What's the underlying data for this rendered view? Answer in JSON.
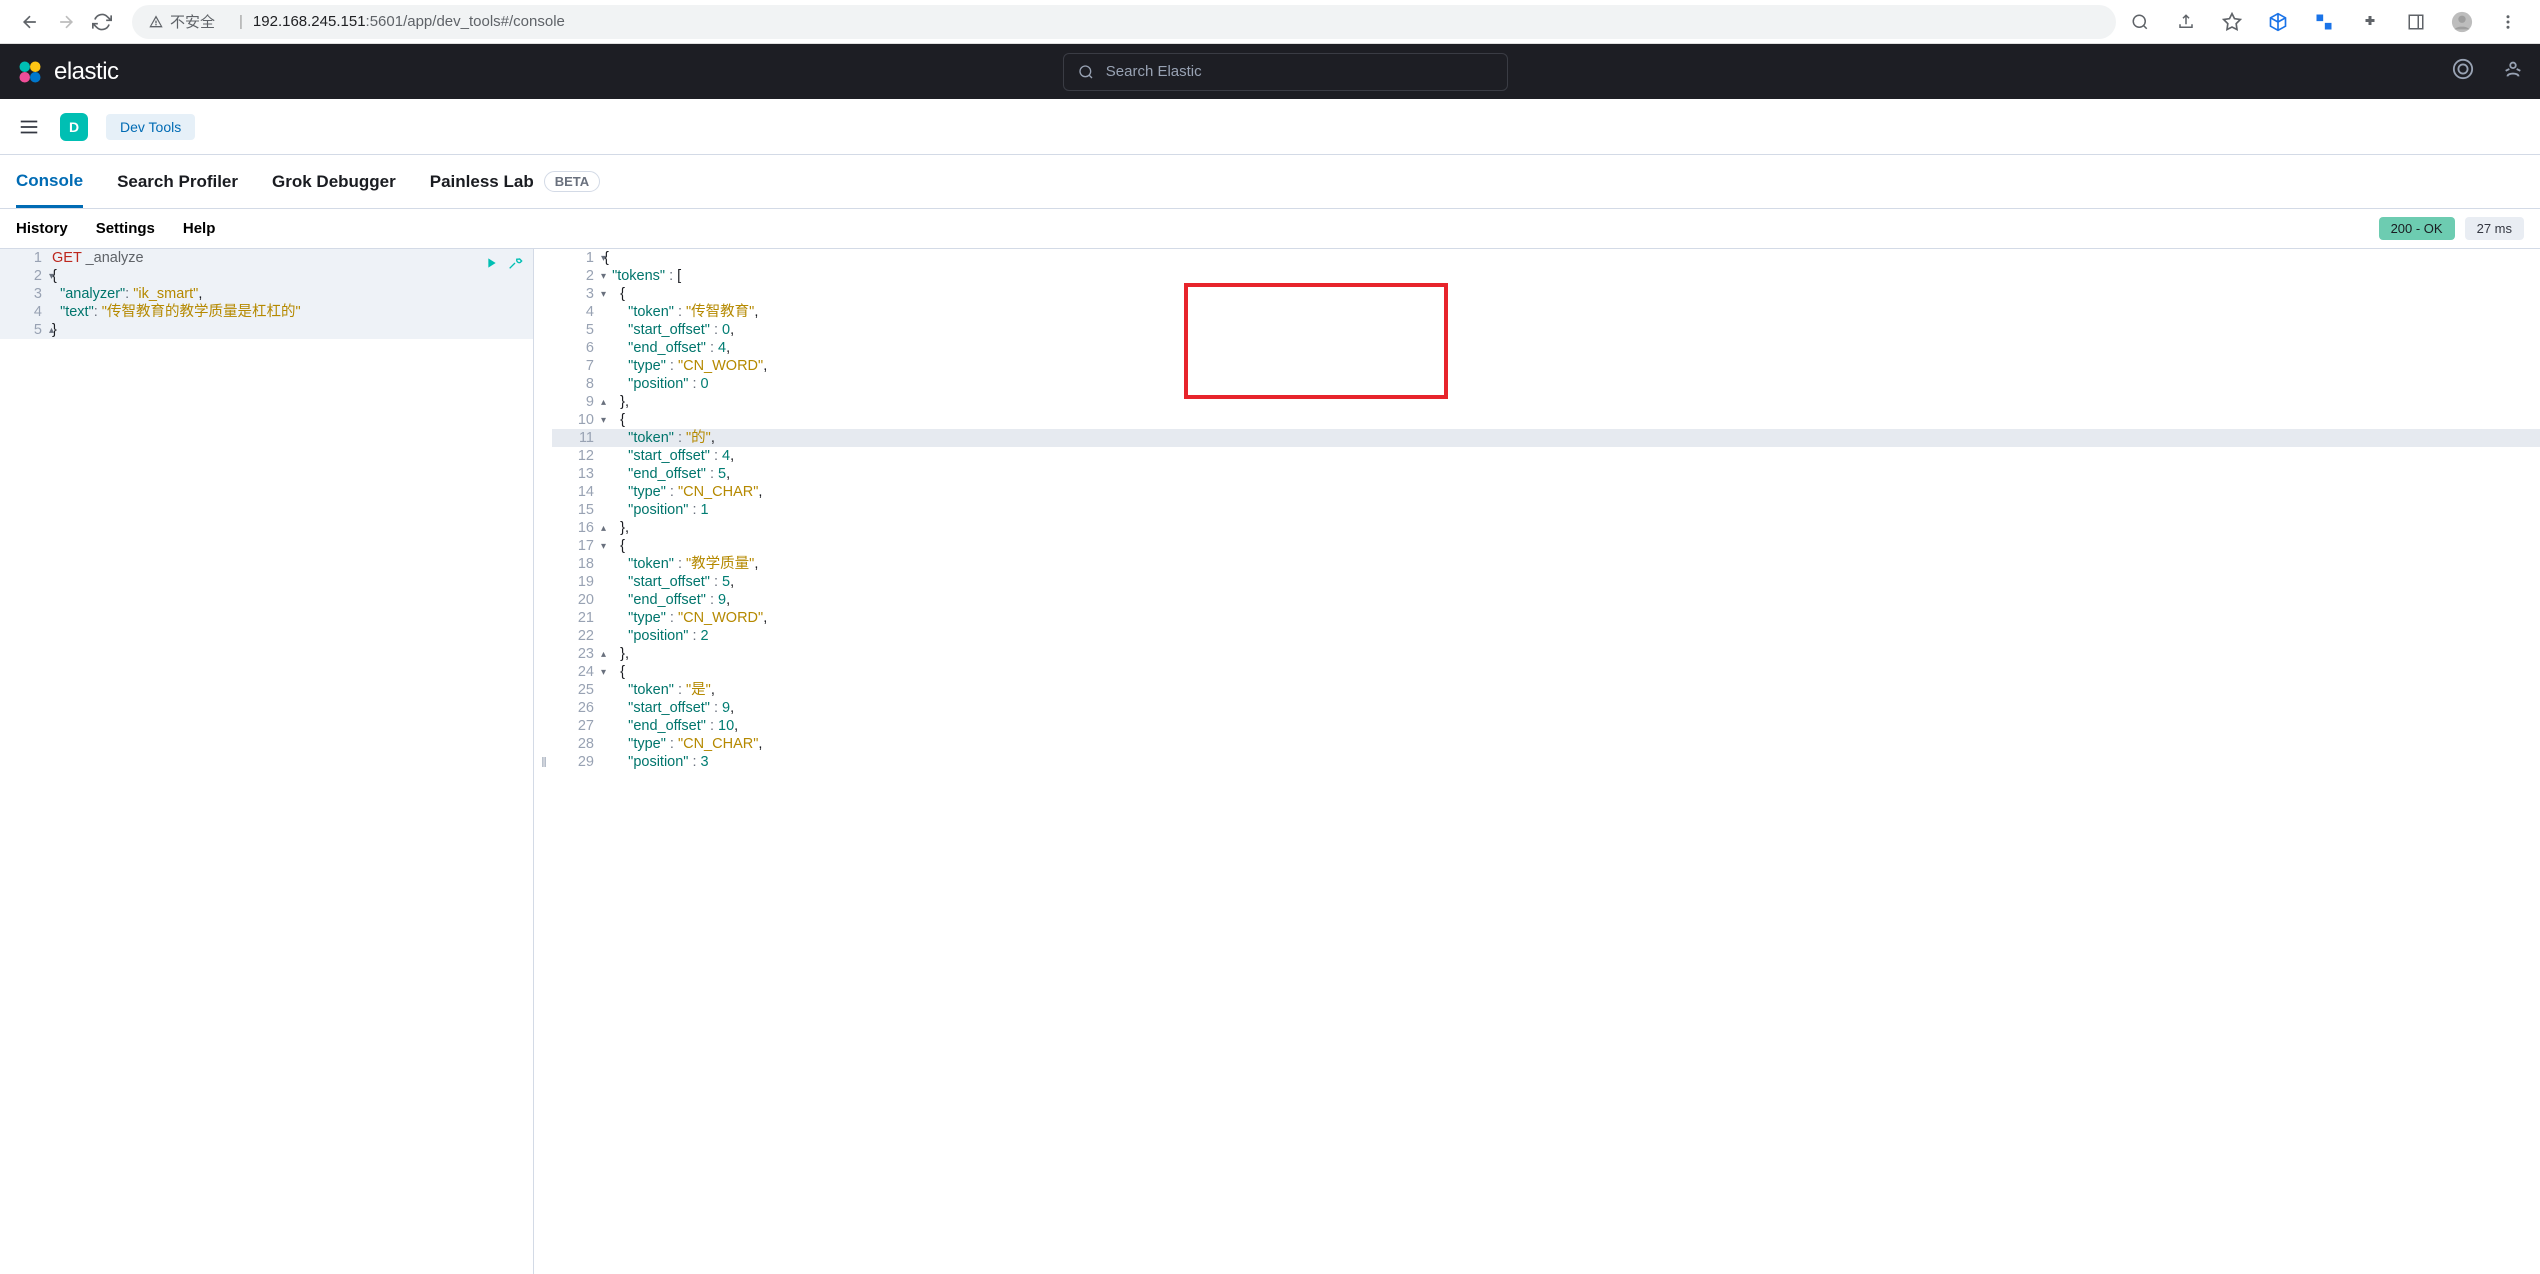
{
  "browser": {
    "insecure_label": "不安全",
    "host": "192.168.245.151",
    "port_path": ":5601/app/dev_tools#/console"
  },
  "header": {
    "brand": "elastic",
    "search_placeholder": "Search Elastic",
    "app_badge_letter": "D",
    "dev_tools_label": "Dev Tools"
  },
  "tabs": [
    {
      "label": "Console",
      "active": true
    },
    {
      "label": "Search Profiler"
    },
    {
      "label": "Grok Debugger"
    },
    {
      "label": "Painless Lab",
      "beta": "BETA"
    }
  ],
  "toolbar": {
    "history": "History",
    "settings": "Settings",
    "help": "Help",
    "status": "200 - OK",
    "time": "27 ms"
  },
  "request": {
    "method": "GET",
    "path": "_analyze",
    "body": {
      "analyzer": "ik_smart",
      "text": "传智教育的教学质量是杠杠的"
    }
  },
  "response_lines": [
    {
      "n": 1,
      "fold": "▾",
      "indent": 0,
      "tokens": [
        {
          "c": "t-brace",
          "t": "{"
        }
      ]
    },
    {
      "n": 2,
      "fold": "▾",
      "indent": 1,
      "tokens": [
        {
          "c": "t-key",
          "t": "\"tokens\""
        },
        {
          "c": "t-colon",
          "t": " : "
        },
        {
          "c": "t-brace",
          "t": "["
        }
      ]
    },
    {
      "n": 3,
      "fold": "▾",
      "indent": 2,
      "tokens": [
        {
          "c": "t-brace",
          "t": "{"
        }
      ]
    },
    {
      "n": 4,
      "indent": 3,
      "tokens": [
        {
          "c": "t-key",
          "t": "\"token\""
        },
        {
          "c": "t-colon",
          "t": " : "
        },
        {
          "c": "t-string",
          "t": "\"传智教育\""
        },
        {
          "c": "t-brace",
          "t": ","
        }
      ]
    },
    {
      "n": 5,
      "indent": 3,
      "tokens": [
        {
          "c": "t-key",
          "t": "\"start_offset\""
        },
        {
          "c": "t-colon",
          "t": " : "
        },
        {
          "c": "t-number",
          "t": "0"
        },
        {
          "c": "t-brace",
          "t": ","
        }
      ]
    },
    {
      "n": 6,
      "indent": 3,
      "tokens": [
        {
          "c": "t-key",
          "t": "\"end_offset\""
        },
        {
          "c": "t-colon",
          "t": " : "
        },
        {
          "c": "t-number",
          "t": "4"
        },
        {
          "c": "t-brace",
          "t": ","
        }
      ]
    },
    {
      "n": 7,
      "indent": 3,
      "tokens": [
        {
          "c": "t-key",
          "t": "\"type\""
        },
        {
          "c": "t-colon",
          "t": " : "
        },
        {
          "c": "t-string",
          "t": "\"CN_WORD\""
        },
        {
          "c": "t-brace",
          "t": ","
        }
      ]
    },
    {
      "n": 8,
      "indent": 3,
      "tokens": [
        {
          "c": "t-key",
          "t": "\"position\""
        },
        {
          "c": "t-colon",
          "t": " : "
        },
        {
          "c": "t-number",
          "t": "0"
        }
      ]
    },
    {
      "n": 9,
      "fold": "▴",
      "indent": 2,
      "tokens": [
        {
          "c": "t-brace",
          "t": "},"
        }
      ]
    },
    {
      "n": 10,
      "fold": "▾",
      "indent": 2,
      "tokens": [
        {
          "c": "t-brace",
          "t": "{"
        }
      ]
    },
    {
      "n": 11,
      "indent": 3,
      "current": true,
      "tokens": [
        {
          "c": "t-key",
          "t": "\"token\""
        },
        {
          "c": "t-colon",
          "t": " : "
        },
        {
          "c": "t-string",
          "t": "\"的\""
        },
        {
          "c": "t-brace",
          "t": ","
        }
      ]
    },
    {
      "n": 12,
      "indent": 3,
      "tokens": [
        {
          "c": "t-key",
          "t": "\"start_offset\""
        },
        {
          "c": "t-colon",
          "t": " : "
        },
        {
          "c": "t-number",
          "t": "4"
        },
        {
          "c": "t-brace",
          "t": ","
        }
      ]
    },
    {
      "n": 13,
      "indent": 3,
      "tokens": [
        {
          "c": "t-key",
          "t": "\"end_offset\""
        },
        {
          "c": "t-colon",
          "t": " : "
        },
        {
          "c": "t-number",
          "t": "5"
        },
        {
          "c": "t-brace",
          "t": ","
        }
      ]
    },
    {
      "n": 14,
      "indent": 3,
      "tokens": [
        {
          "c": "t-key",
          "t": "\"type\""
        },
        {
          "c": "t-colon",
          "t": " : "
        },
        {
          "c": "t-string",
          "t": "\"CN_CHAR\""
        },
        {
          "c": "t-brace",
          "t": ","
        }
      ]
    },
    {
      "n": 15,
      "indent": 3,
      "tokens": [
        {
          "c": "t-key",
          "t": "\"position\""
        },
        {
          "c": "t-colon",
          "t": " : "
        },
        {
          "c": "t-number",
          "t": "1"
        }
      ]
    },
    {
      "n": 16,
      "fold": "▴",
      "indent": 2,
      "tokens": [
        {
          "c": "t-brace",
          "t": "},"
        }
      ]
    },
    {
      "n": 17,
      "fold": "▾",
      "indent": 2,
      "tokens": [
        {
          "c": "t-brace",
          "t": "{"
        }
      ]
    },
    {
      "n": 18,
      "indent": 3,
      "tokens": [
        {
          "c": "t-key",
          "t": "\"token\""
        },
        {
          "c": "t-colon",
          "t": " : "
        },
        {
          "c": "t-string",
          "t": "\"教学质量\""
        },
        {
          "c": "t-brace",
          "t": ","
        }
      ]
    },
    {
      "n": 19,
      "indent": 3,
      "tokens": [
        {
          "c": "t-key",
          "t": "\"start_offset\""
        },
        {
          "c": "t-colon",
          "t": " : "
        },
        {
          "c": "t-number",
          "t": "5"
        },
        {
          "c": "t-brace",
          "t": ","
        }
      ]
    },
    {
      "n": 20,
      "indent": 3,
      "tokens": [
        {
          "c": "t-key",
          "t": "\"end_offset\""
        },
        {
          "c": "t-colon",
          "t": " : "
        },
        {
          "c": "t-number",
          "t": "9"
        },
        {
          "c": "t-brace",
          "t": ","
        }
      ]
    },
    {
      "n": 21,
      "indent": 3,
      "tokens": [
        {
          "c": "t-key",
          "t": "\"type\""
        },
        {
          "c": "t-colon",
          "t": " : "
        },
        {
          "c": "t-string",
          "t": "\"CN_WORD\""
        },
        {
          "c": "t-brace",
          "t": ","
        }
      ]
    },
    {
      "n": 22,
      "indent": 3,
      "tokens": [
        {
          "c": "t-key",
          "t": "\"position\""
        },
        {
          "c": "t-colon",
          "t": " : "
        },
        {
          "c": "t-number",
          "t": "2"
        }
      ]
    },
    {
      "n": 23,
      "fold": "▴",
      "indent": 2,
      "tokens": [
        {
          "c": "t-brace",
          "t": "},"
        }
      ]
    },
    {
      "n": 24,
      "fold": "▾",
      "indent": 2,
      "tokens": [
        {
          "c": "t-brace",
          "t": "{"
        }
      ]
    },
    {
      "n": 25,
      "indent": 3,
      "tokens": [
        {
          "c": "t-key",
          "t": "\"token\""
        },
        {
          "c": "t-colon",
          "t": " : "
        },
        {
          "c": "t-string",
          "t": "\"是\""
        },
        {
          "c": "t-brace",
          "t": ","
        }
      ]
    },
    {
      "n": 26,
      "indent": 3,
      "tokens": [
        {
          "c": "t-key",
          "t": "\"start_offset\""
        },
        {
          "c": "t-colon",
          "t": " : "
        },
        {
          "c": "t-number",
          "t": "9"
        },
        {
          "c": "t-brace",
          "t": ","
        }
      ]
    },
    {
      "n": 27,
      "indent": 3,
      "tokens": [
        {
          "c": "t-key",
          "t": "\"end_offset\""
        },
        {
          "c": "t-colon",
          "t": " : "
        },
        {
          "c": "t-number",
          "t": "10"
        },
        {
          "c": "t-brace",
          "t": ","
        }
      ]
    },
    {
      "n": 28,
      "indent": 3,
      "tokens": [
        {
          "c": "t-key",
          "t": "\"type\""
        },
        {
          "c": "t-colon",
          "t": " : "
        },
        {
          "c": "t-string",
          "t": "\"CN_CHAR\""
        },
        {
          "c": "t-brace",
          "t": ","
        }
      ]
    },
    {
      "n": 29,
      "indent": 3,
      "tokens": [
        {
          "c": "t-key",
          "t": "\"position\""
        },
        {
          "c": "t-colon",
          "t": " : "
        },
        {
          "c": "t-number",
          "t": "3"
        }
      ]
    }
  ]
}
